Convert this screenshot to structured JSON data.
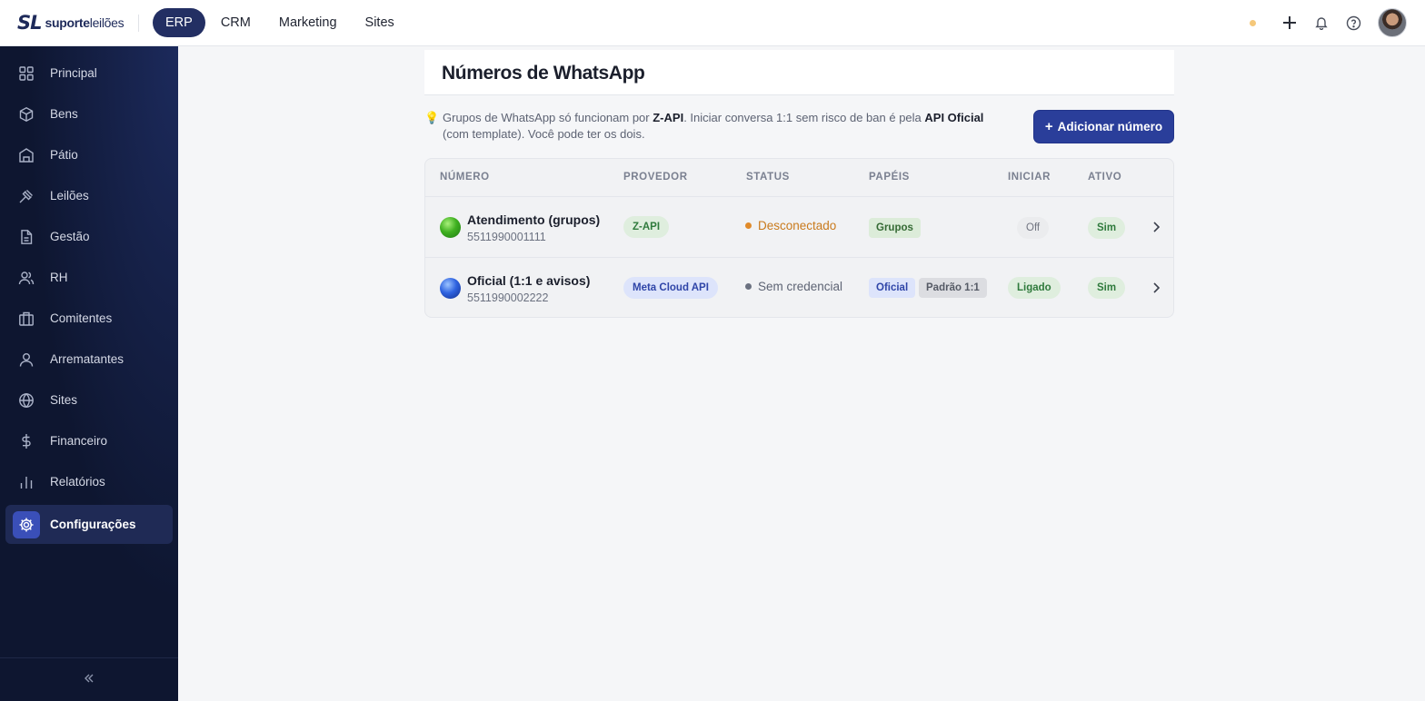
{
  "brand": {
    "mark": "SL",
    "name_bold": "suporte",
    "name_light": "leilões"
  },
  "topnav": [
    {
      "label": "ERP",
      "active": true
    },
    {
      "label": "CRM",
      "active": false
    },
    {
      "label": "Marketing",
      "active": false
    },
    {
      "label": "Sites",
      "active": false
    }
  ],
  "topbar_icons": [
    "status-dot",
    "plus-icon",
    "bell-icon",
    "help-icon",
    "avatar"
  ],
  "sidebar": {
    "items": [
      {
        "label": "Principal",
        "icon": "grid-icon"
      },
      {
        "label": "Bens",
        "icon": "box-icon"
      },
      {
        "label": "Pátio",
        "icon": "warehouse-icon"
      },
      {
        "label": "Leilões",
        "icon": "gavel-icon"
      },
      {
        "label": "Gestão",
        "icon": "document-icon"
      },
      {
        "label": "RH",
        "icon": "users-icon"
      },
      {
        "label": "Comitentes",
        "icon": "briefcase-icon"
      },
      {
        "label": "Arrematantes",
        "icon": "user-icon"
      },
      {
        "label": "Sites",
        "icon": "globe-icon"
      },
      {
        "label": "Financeiro",
        "icon": "dollar-icon"
      },
      {
        "label": "Relatórios",
        "icon": "bar-chart-icon"
      },
      {
        "label": "Configurações",
        "icon": "gear-icon",
        "active": true
      }
    ],
    "collapse_icon": "double-chevron-left-icon"
  },
  "page": {
    "title": "Números de WhatsApp",
    "tip": {
      "p1": "Grupos de WhatsApp só funcionam por ",
      "b1": "Z-API",
      "p2": ". Iniciar conversa 1:1 sem risco de ban é pela ",
      "b2": "API Oficial",
      "p3": " (com template). Você pode ter os dois."
    },
    "add_button": "Adicionar número"
  },
  "table": {
    "headers": [
      "Número",
      "Provedor",
      "Status",
      "Papéis",
      "Iniciar",
      "Ativo"
    ],
    "rows": [
      {
        "name": "Atendimento (grupos)",
        "number": "5511990001111",
        "provider": "Z-API",
        "status": "Desconectado",
        "roles": [
          "Grupos"
        ],
        "iniciar": "Off",
        "ativo": "Sim"
      },
      {
        "name": "Oficial (1:1 e avisos)",
        "number": "5511990002222",
        "provider": "Meta Cloud API",
        "status": "Sem credencial",
        "roles": [
          "Oficial",
          "Padrão 1:1"
        ],
        "iniciar": "Ligado",
        "ativo": "Sim"
      }
    ]
  },
  "colors": {
    "primary": "#2a3e9a",
    "nav_active": "#232f63",
    "sidebar_bg": "#0e1630",
    "status_warn": "#c97a1c"
  }
}
